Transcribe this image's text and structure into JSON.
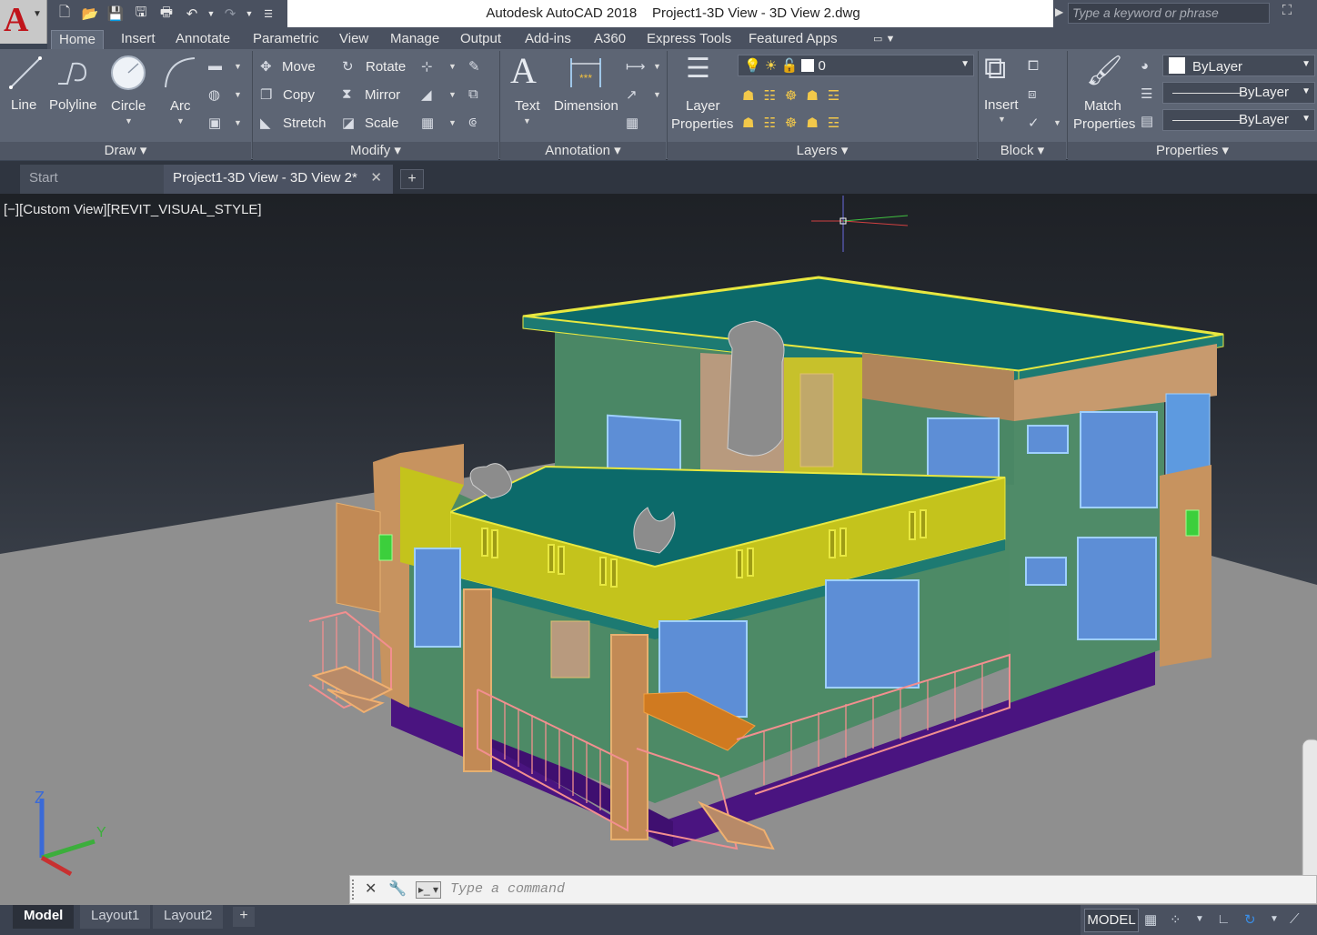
{
  "app": {
    "logo": "A",
    "title": "Autodesk AutoCAD 2018",
    "filename": "Project1-3D View - 3D View 2.dwg",
    "search_placeholder": "Type a keyword or phrase"
  },
  "menu_tabs": [
    "Home",
    "Insert",
    "Annotate",
    "Parametric",
    "View",
    "Manage",
    "Output",
    "Add-ins",
    "A360",
    "Express Tools",
    "Featured Apps"
  ],
  "active_tab": "Home",
  "ribbon": {
    "draw": {
      "title": "Draw",
      "line": "Line",
      "polyline": "Polyline",
      "circle": "Circle",
      "arc": "Arc"
    },
    "modify": {
      "title": "Modify",
      "move": "Move",
      "rotate": "Rotate",
      "copy": "Copy",
      "mirror": "Mirror",
      "stretch": "Stretch",
      "scale": "Scale"
    },
    "annotation": {
      "title": "Annotation",
      "text": "Text",
      "dimension": "Dimension"
    },
    "layers": {
      "title": "Layers",
      "layer_properties_1": "Layer",
      "layer_properties_2": "Properties",
      "current_layer": "0"
    },
    "block": {
      "title": "Block",
      "insert": "Insert"
    },
    "properties": {
      "title": "Properties",
      "match_1": "Match",
      "match_2": "Properties",
      "color": "ByLayer",
      "linetype": "ByLayer",
      "lineweight": "ByLayer"
    }
  },
  "doc_tabs": {
    "start": "Start",
    "active": "Project1-3D View - 3D View 2*",
    "close": "✕",
    "new": "+"
  },
  "viewport": {
    "label": "[−][Custom View][REVIT_VISUAL_STYLE]",
    "ucs_z": "Z",
    "ucs_y": "Y"
  },
  "command": {
    "placeholder": "Type a command"
  },
  "status": {
    "layouts": [
      "Model",
      "Layout1",
      "Layout2"
    ],
    "active_layout": "Model",
    "add": "+",
    "model_button": "MODEL"
  }
}
